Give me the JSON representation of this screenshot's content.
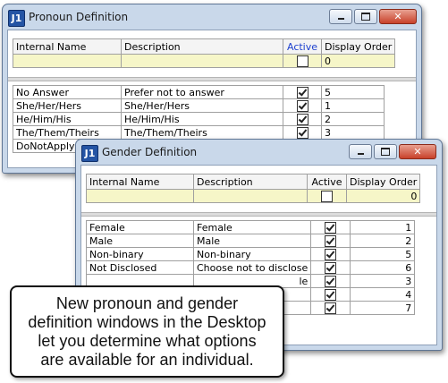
{
  "pronoun_window": {
    "title": "Pronoun Definition",
    "logo": "J1",
    "columns": [
      "Internal Name",
      "Description",
      "Active",
      "Display Order"
    ],
    "new_row": {
      "internal_name": "",
      "description": "",
      "active": false,
      "display_order": "0"
    },
    "rows": [
      {
        "internal_name": "No Answer",
        "description": "Prefer not to answer",
        "active": true,
        "display_order": "5"
      },
      {
        "internal_name": "She/Her/Hers",
        "description": "She/Her/Hers",
        "active": true,
        "display_order": "1"
      },
      {
        "internal_name": "He/Him/His",
        "description": "He/Him/His",
        "active": true,
        "display_order": "2"
      },
      {
        "internal_name": "The/Them/Theirs",
        "description": "The/Them/Theirs",
        "active": true,
        "display_order": "3"
      },
      {
        "internal_name": "DoNotApply",
        "description": "",
        "active": true,
        "display_order": ""
      }
    ]
  },
  "gender_window": {
    "title": "Gender Definition",
    "logo": "J1",
    "columns": [
      "Internal Name",
      "Description",
      "Active",
      "Display Order"
    ],
    "new_row": {
      "internal_name": "",
      "description": "",
      "active": false,
      "display_order": "0"
    },
    "rows": [
      {
        "internal_name": "Female",
        "description": "Female",
        "active": true,
        "display_order": "1"
      },
      {
        "internal_name": "Male",
        "description": "Male",
        "active": true,
        "display_order": "2"
      },
      {
        "internal_name": "Non-binary",
        "description": "Non-binary",
        "active": true,
        "display_order": "5"
      },
      {
        "internal_name": "Not Disclosed",
        "description": "Choose not to disclose",
        "active": true,
        "display_order": "6"
      },
      {
        "internal_name": "",
        "description": "le",
        "active": true,
        "display_order": "3"
      },
      {
        "internal_name": "",
        "description": "",
        "active": true,
        "display_order": "4"
      },
      {
        "internal_name": "",
        "description": "",
        "active": true,
        "display_order": "7"
      }
    ]
  },
  "window_controls": {
    "minimize_icon": "minimize-icon",
    "maximize_icon": "maximize-icon",
    "close_icon": "close-icon",
    "close_glyph": "✕"
  },
  "callout": {
    "lines": [
      "New pronoun and gender",
      "definition windows in the Desktop",
      "let you determine what options",
      "are available for an individual."
    ]
  }
}
